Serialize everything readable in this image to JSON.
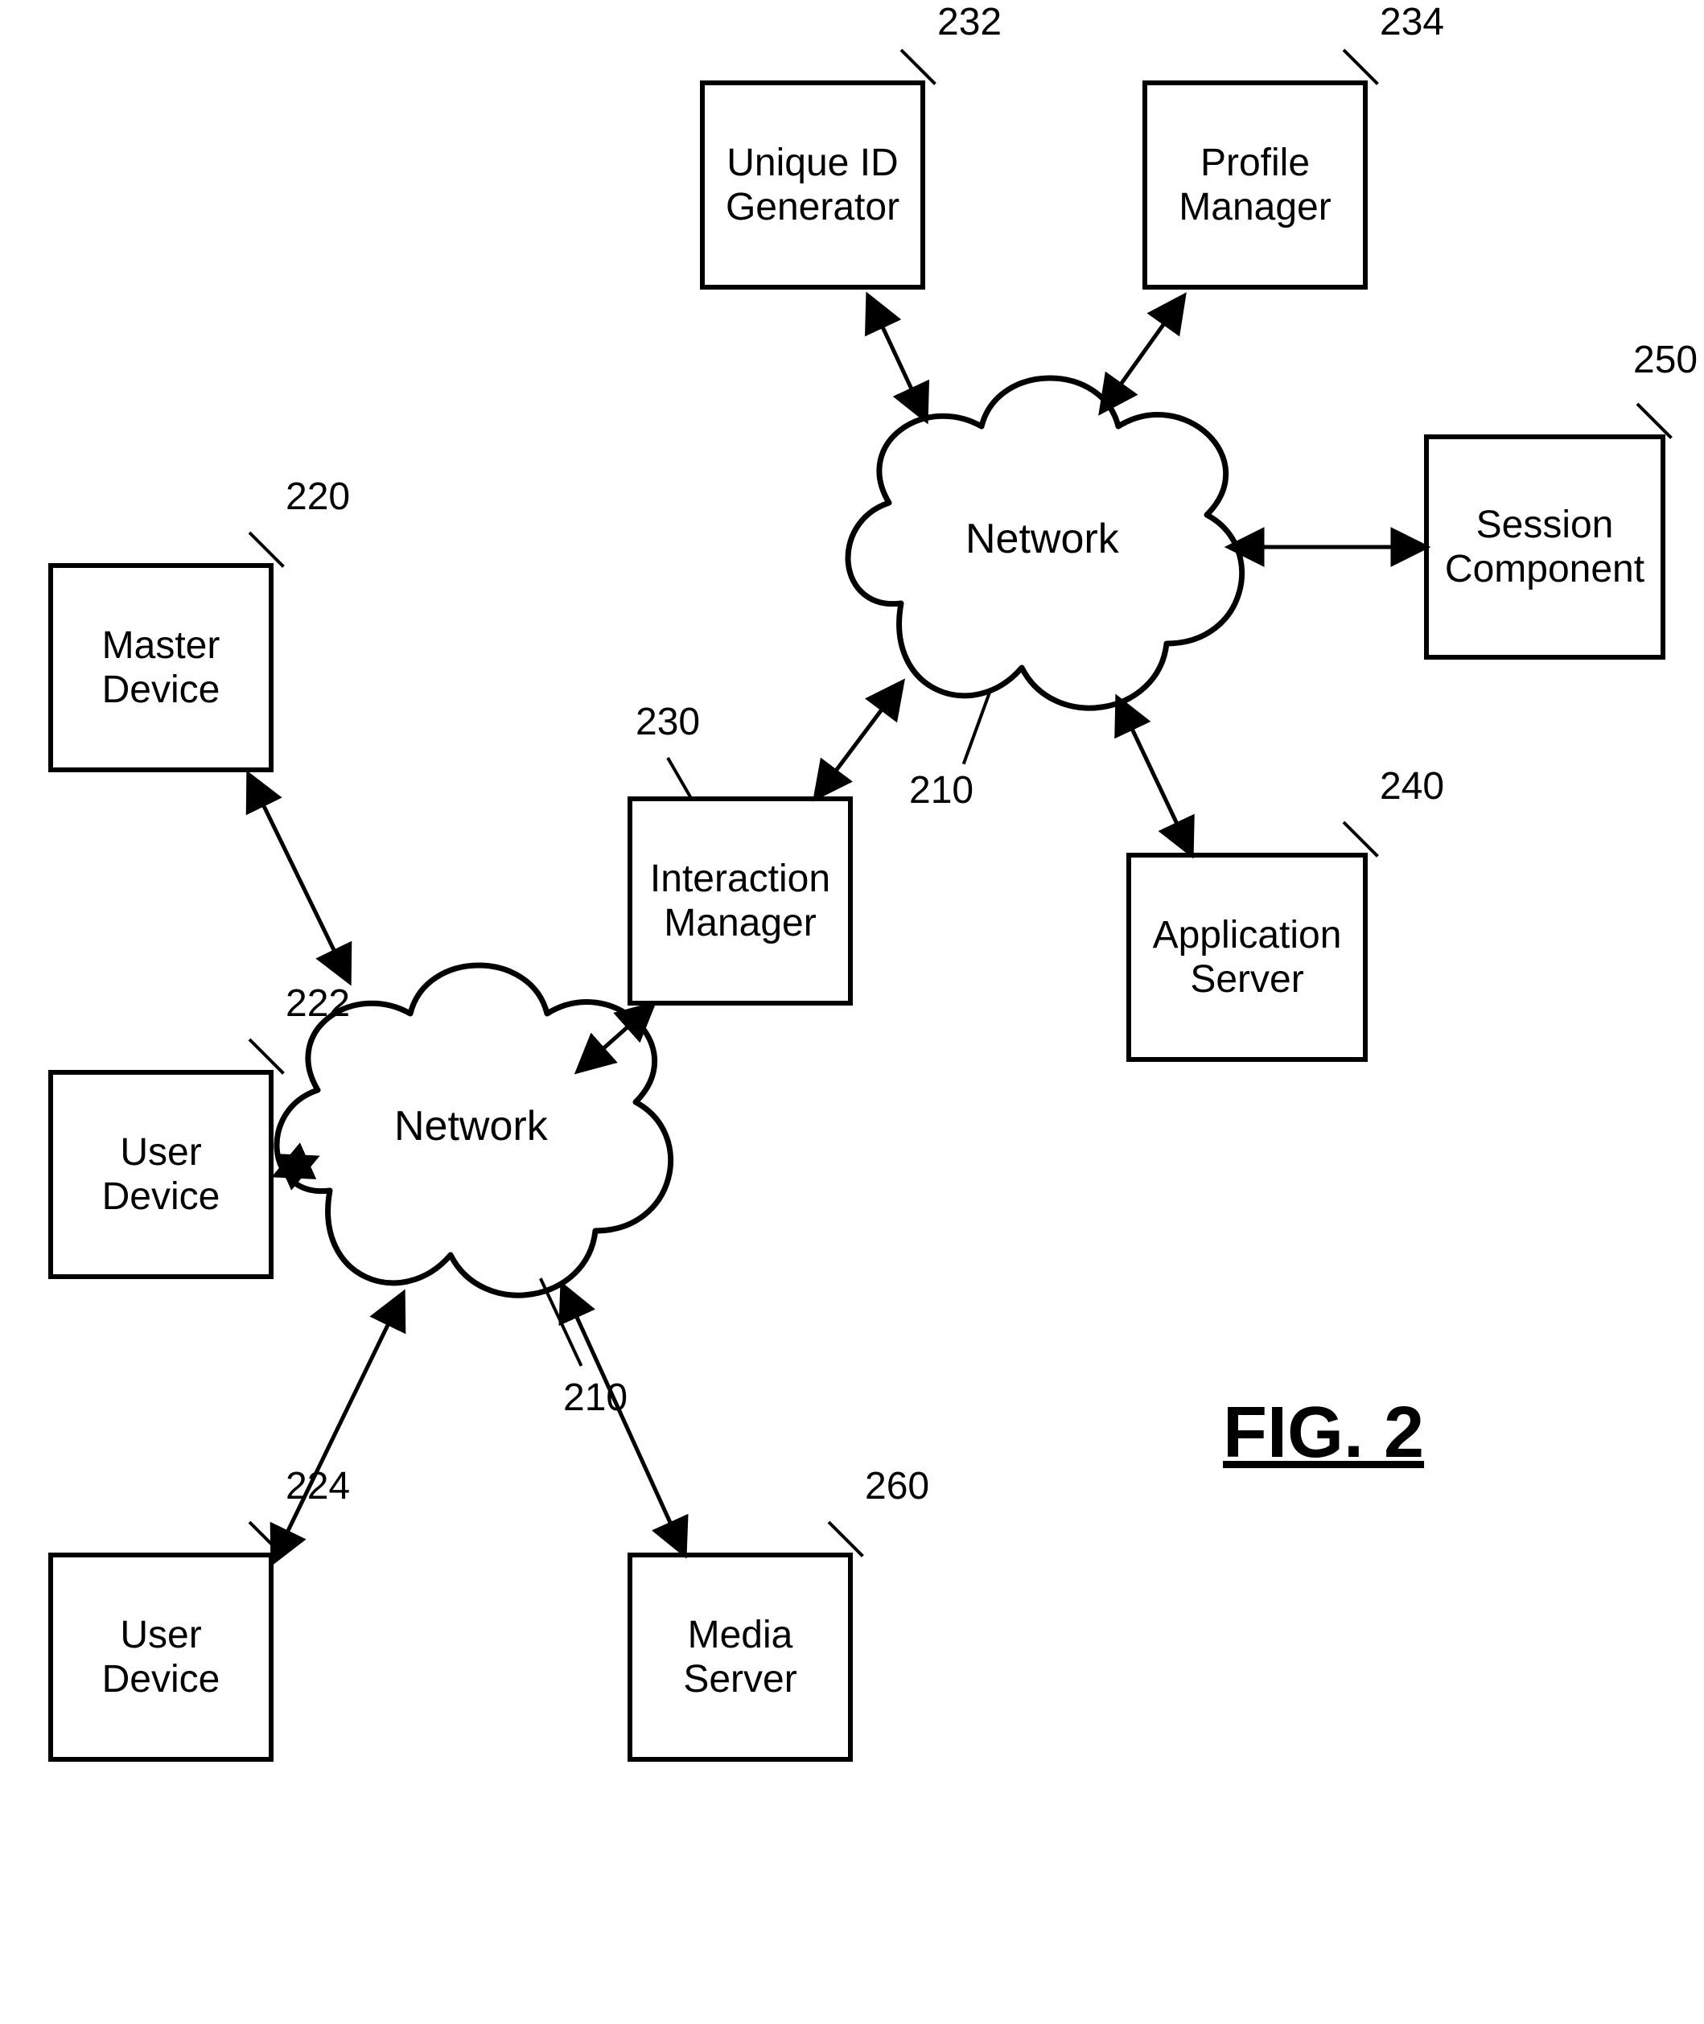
{
  "figure_label": "FIG. 2",
  "nodes": {
    "master_device": {
      "line1": "Master",
      "line2": "Device",
      "ref": "220"
    },
    "user_device_1": {
      "line1": "User",
      "line2": "Device",
      "ref": "222"
    },
    "user_device_2": {
      "line1": "User",
      "line2": "Device",
      "ref": "224"
    },
    "interaction_manager": {
      "line1": "Interaction",
      "line2": "Manager",
      "ref": "230"
    },
    "unique_id_generator": {
      "line1": "Unique ID",
      "line2": "Generator",
      "ref": "232"
    },
    "profile_manager": {
      "line1": "Profile",
      "line2": "Manager",
      "ref": "234"
    },
    "session_component": {
      "line1": "Session",
      "line2": "Component",
      "ref": "250"
    },
    "application_server": {
      "line1": "Application",
      "line2": "Server",
      "ref": "240"
    },
    "media_server": {
      "line1": "Media",
      "line2": "Server",
      "ref": "260"
    },
    "network_left": {
      "label": "Network",
      "ref": "210"
    },
    "network_right": {
      "label": "Network",
      "ref": "210"
    }
  }
}
